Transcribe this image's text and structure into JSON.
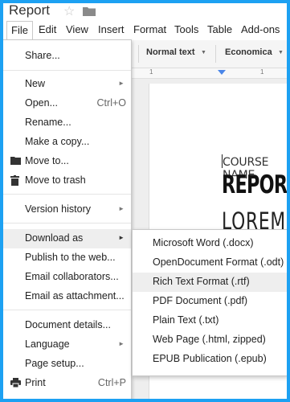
{
  "document": {
    "title": "Report"
  },
  "menubar": {
    "items": [
      "File",
      "Edit",
      "View",
      "Insert",
      "Format",
      "Tools",
      "Table",
      "Add-ons"
    ]
  },
  "toolbar": {
    "style": "Normal text",
    "font": "Economica"
  },
  "ruler": {
    "marks": [
      "1",
      "1"
    ]
  },
  "page": {
    "course_name": "COURSE NAME",
    "heading": "REPOR",
    "subheading": "LOREM"
  },
  "file_menu": {
    "items": [
      {
        "label": "Share..."
      },
      {
        "label": "New"
      },
      {
        "label": "Open...",
        "shortcut": "Ctrl+O"
      },
      {
        "label": "Rename..."
      },
      {
        "label": "Make a copy..."
      },
      {
        "label": "Move to...",
        "icon": "folder-icon"
      },
      {
        "label": "Move to trash",
        "icon": "trash-icon"
      },
      {
        "label": "Version history"
      },
      {
        "label": "Download as"
      },
      {
        "label": "Publish to the web..."
      },
      {
        "label": "Email collaborators..."
      },
      {
        "label": "Email as attachment..."
      },
      {
        "label": "Document details..."
      },
      {
        "label": "Language"
      },
      {
        "label": "Page setup..."
      },
      {
        "label": "Print",
        "shortcut": "Ctrl+P",
        "icon": "printer-icon"
      }
    ]
  },
  "download_menu": {
    "items": [
      "Microsoft Word (.docx)",
      "OpenDocument Format (.odt)",
      "Rich Text Format (.rtf)",
      "PDF Document (.pdf)",
      "Plain Text (.txt)",
      "Web Page (.html, zipped)",
      "EPUB Publication (.epub)"
    ],
    "highlighted": "Rich Text Format (.rtf)"
  },
  "colors": {
    "frame_border": "#1da1f2",
    "ruler_marker": "#4a86e8",
    "menu_highlight": "#eeeeee"
  }
}
